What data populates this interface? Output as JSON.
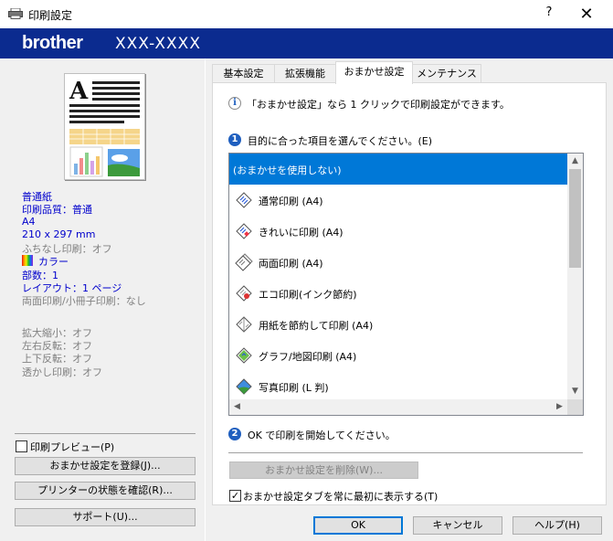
{
  "window": {
    "title": "印刷設定",
    "help_glyph": "?",
    "close_glyph": "✕"
  },
  "brand": {
    "logo": "brother",
    "model": "XXX-XXXX"
  },
  "summary": {
    "paper_type": "普通紙",
    "quality": "印刷品質：普通",
    "paper_size": "A4",
    "dimensions": "210 x 297 mm",
    "borderless": "ふちなし印刷：オフ",
    "color": "カラー",
    "copies": "部数：1",
    "layout": "レイアウト：1 ページ",
    "duplex": "両面印刷/小冊子印刷：なし",
    "scaling": "拡大縮小：オフ",
    "mirror": "左右反転：オフ",
    "reverse": "上下反転：オフ",
    "watermark": "透かし印刷：オフ"
  },
  "left_actions": {
    "print_preview": "印刷プレビュー(P)",
    "register_button": "おまかせ設定を登録(J)...",
    "status_button": "プリンターの状態を確認(R)...",
    "support_button": "サポート(U)..."
  },
  "tabs": [
    {
      "label": "基本設定",
      "active": false
    },
    {
      "label": "拡張機能",
      "active": false
    },
    {
      "label": "おまかせ設定",
      "active": true
    },
    {
      "label": "メンテナンス",
      "active": false
    }
  ],
  "panel": {
    "info_icon": "i",
    "info_text": "「おまかせ設定」なら 1 クリックで印刷設定ができます。",
    "step1_num": "1",
    "step1_text": "目的に合った項目を選んでください。(E)",
    "step2_num": "2",
    "step2_text": "OK で印刷を開始してください。",
    "delete_button": "おまかせ設定を削除(W)...",
    "always_show": "おまかせ設定タブを常に最初に表示する(T)",
    "always_show_checked": true
  },
  "presets": [
    {
      "label": "(おまかせを使用しない)",
      "icon": "none",
      "selected": true
    },
    {
      "label": "通常印刷 (A4)",
      "icon": "document-print-icon",
      "selected": false
    },
    {
      "label": "きれいに印刷 (A4)",
      "icon": "fine-print-icon",
      "selected": false
    },
    {
      "label": "両面印刷 (A4)",
      "icon": "duplex-print-icon",
      "selected": false
    },
    {
      "label": "エコ印刷(インク節約)",
      "icon": "eco-print-icon",
      "selected": false
    },
    {
      "label": "用紙を節約して印刷 (A4)",
      "icon": "paper-save-icon",
      "selected": false
    },
    {
      "label": "グラフ/地図印刷 (A4)",
      "icon": "graph-map-icon",
      "selected": false
    },
    {
      "label": "写真印刷 (L 判)",
      "icon": "photo-print-icon",
      "selected": false
    }
  ],
  "footer": {
    "ok": "OK",
    "cancel": "キャンセル",
    "help": "ヘルプ(H)"
  },
  "colors": {
    "brand_blue": "#0b2b8f",
    "selection": "#0078d7",
    "summary_text": "#0000cc",
    "step_icon": "#1f5fbf"
  }
}
